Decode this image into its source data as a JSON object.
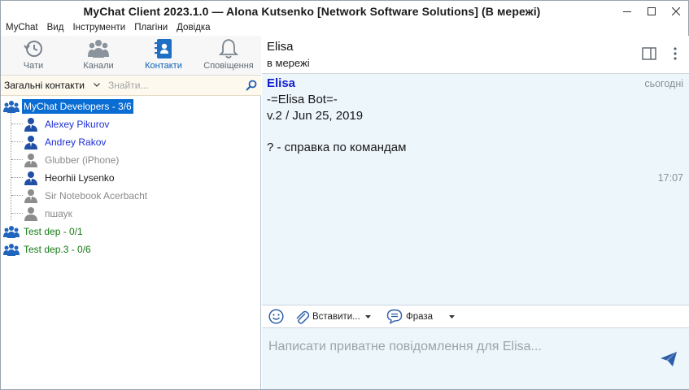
{
  "window": {
    "title": "MyChat Client 2023.1.0 — Alona Kutsenko [Network Software Solutions] (В мережі)",
    "controls": [
      "minimize-icon",
      "maximize-icon",
      "close-icon"
    ]
  },
  "menu": [
    "MyChat",
    "Вид",
    "Інструменти",
    "Плагіни",
    "Довідка"
  ],
  "nav": [
    {
      "label": "Чати",
      "icon": "history-icon"
    },
    {
      "label": "Канали",
      "icon": "channels-icon"
    },
    {
      "label": "Контакти",
      "icon": "contacts-icon",
      "active": true
    },
    {
      "label": "Сповіщення",
      "icon": "bell-icon"
    }
  ],
  "search": {
    "filter_label": "Загальні контакти",
    "placeholder": "Знайти..."
  },
  "tree": {
    "groups": [
      {
        "label": "MyChat Developers - 3/6",
        "selected": true,
        "members": [
          {
            "name": "Alexey Pikurov",
            "status": "online"
          },
          {
            "name": "Andrey Rakov",
            "status": "online"
          },
          {
            "name": "Glubber (iPhone)",
            "status": "offline"
          },
          {
            "name": "Heorhii Lysenko",
            "status": "online-self"
          },
          {
            "name": "Sir Notebook Acerbacht",
            "status": "offline"
          },
          {
            "name": "пшаук",
            "status": "offline"
          }
        ]
      },
      {
        "label": "Test dep - 0/1"
      },
      {
        "label": "Test dep.3 - 0/6"
      }
    ]
  },
  "chat": {
    "name": "Elisa",
    "status": "в мережі",
    "message": {
      "author": "Elisa",
      "date": "сьогодні",
      "lines": [
        "-=Elisa Bot=-",
        "v.2 / Jun 25, 2019",
        "",
        "? - справка по командам"
      ],
      "time": "17:07"
    },
    "toolbar": {
      "insert_label": "Вставити...",
      "phrase_label": "Фраза"
    },
    "compose_placeholder": "Написати приватне повідомлення для Elisa..."
  },
  "colors": {
    "accent": "#0a6dd3",
    "online_user": "#1d2fd4",
    "group_green": "#157a15",
    "chat_bg": "#ecf6fb",
    "author": "#1420d0"
  }
}
